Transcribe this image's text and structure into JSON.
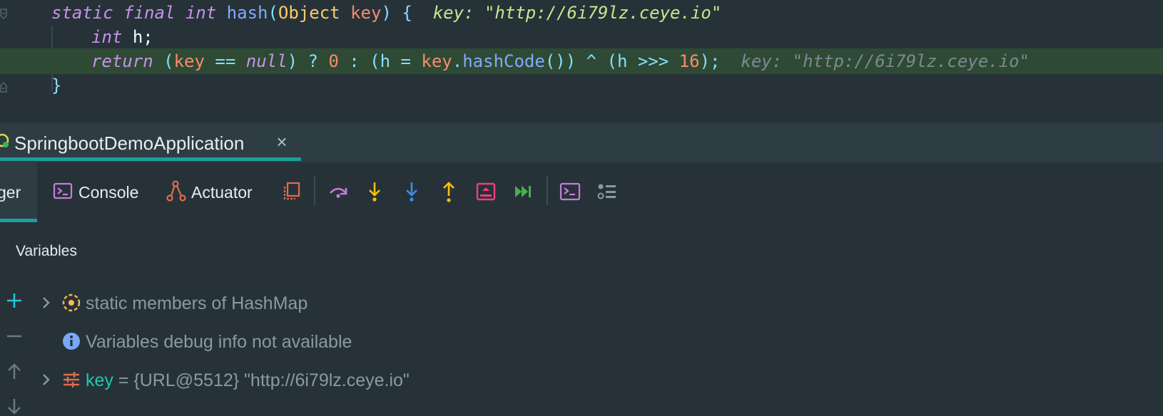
{
  "editor": {
    "line1": {
      "kw_static": "static",
      "kw_final": "final",
      "kw_int": "int",
      "fn_name": "hash",
      "paren_open": "(",
      "type_object": "Object",
      "param_key": "key",
      "paren_close_brace": ") {",
      "hint_name": "key:",
      "hint_value": "\"http://6i79lz.ceye.io\""
    },
    "line2": {
      "kw_int": "int",
      "rest": "h;"
    },
    "line3": {
      "kw_return": "return",
      "p1": "(",
      "key1": "key",
      "eq": " == ",
      "kw_null": "null",
      "p2": ") ? ",
      "zero": "0",
      "colon": " : (h = ",
      "key2": "key",
      "dot": ".",
      "fn_hashcode": "hashCode",
      "p3": "()) ^ (h >>> ",
      "sixteen": "16",
      "p4": ");",
      "hint_name": "key:",
      "hint_value": "\"http://6i79lz.ceye.io\""
    },
    "line4": {
      "brace": "}"
    }
  },
  "run_tab": {
    "label": "SpringbootDemoApplication",
    "close": "×",
    "accent_color": "#1e9e9b"
  },
  "toolbar": {
    "debugger_label": "ger",
    "console_label": "Console",
    "actuator_label": "Actuator",
    "icons": [
      "frames-icon",
      "step-over-icon",
      "step-into-icon",
      "force-step-into-icon",
      "step-out-icon",
      "run-to-cursor-icon",
      "resume-icon",
      "evaluate-expression-icon",
      "threads-icon"
    ]
  },
  "variables": {
    "title": "Variables",
    "rows": [
      {
        "text": "static members of HashMap",
        "icon": "static-members-icon",
        "expandable": true
      },
      {
        "text": "Variables debug info not available",
        "icon": "info-icon",
        "expandable": false
      },
      {
        "name": "key",
        "value": " = {URL@5512} \"http://6i79lz.ceye.io\"",
        "icon": "field-icon",
        "expandable": true
      }
    ],
    "side_buttons": [
      "add-icon",
      "remove-icon",
      "move-up-icon",
      "move-down-icon"
    ]
  }
}
